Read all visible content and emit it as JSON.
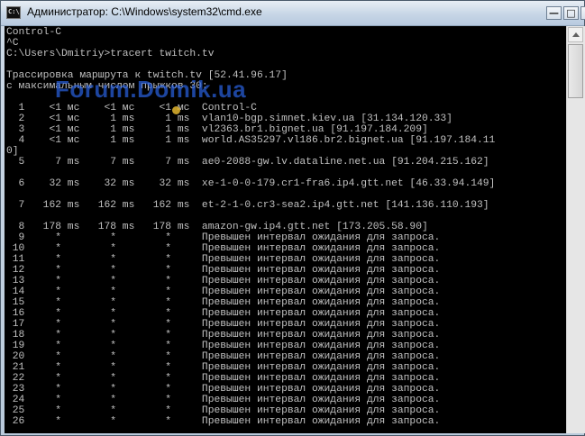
{
  "window": {
    "title": "Администратор: C:\\Windows\\system32\\cmd.exe",
    "buttons": {
      "minimize": "—",
      "maximize": "□",
      "close": ""
    }
  },
  "watermark": "Forum.Domik.ua",
  "console": {
    "lines": [
      "Control-C",
      "^C",
      "C:\\Users\\Dmitriy>tracert twitch.tv",
      "",
      "Трассировка маршрута к twitch.tv [52.41.96.17]",
      "с максимальным числом прыжков 30:",
      "",
      "  1    <1 мс    <1 мс    <1 мс  Control-C",
      "  2    <1 мс     1 ms     1 ms  vlan10-bgp.simnet.kiev.ua [31.134.120.33]",
      "  3    <1 мс     1 ms     1 ms  vl2363.br1.bignet.ua [91.197.184.209]",
      "  4    <1 мс     1 ms     1 ms  world.AS35297.vl186.br2.bignet.ua [91.197.184.11",
      "0]",
      "  5     7 ms     7 ms     7 ms  ae0-2088-gw.lv.dataline.net.ua [91.204.215.162]",
      "",
      "  6    32 ms    32 ms    32 ms  xe-1-0-0-179.cr1-fra6.ip4.gtt.net [46.33.94.149]",
      "",
      "  7   162 ms   162 ms   162 ms  et-2-1-0.cr3-sea2.ip4.gtt.net [141.136.110.193]",
      "",
      "  8   178 ms   178 ms   178 ms  amazon-gw.ip4.gtt.net [173.205.58.90]",
      "  9     *        *        *     Превышен интервал ожидания для запроса.",
      " 10     *        *        *     Превышен интервал ожидания для запроса.",
      " 11     *        *        *     Превышен интервал ожидания для запроса.",
      " 12     *        *        *     Превышен интервал ожидания для запроса.",
      " 13     *        *        *     Превышен интервал ожидания для запроса.",
      " 14     *        *        *     Превышен интервал ожидания для запроса.",
      " 15     *        *        *     Превышен интервал ожидания для запроса.",
      " 16     *        *        *     Превышен интервал ожидания для запроса.",
      " 17     *        *        *     Превышен интервал ожидания для запроса.",
      " 18     *        *        *     Превышен интервал ожидания для запроса.",
      " 19     *        *        *     Превышен интервал ожидания для запроса.",
      " 20     *        *        *     Превышен интервал ожидания для запроса.",
      " 21     *        *        *     Превышен интервал ожидания для запроса.",
      " 22     *        *        *     Превышен интервал ожидания для запроса.",
      " 23     *        *        *     Превышен интервал ожидания для запроса.",
      " 24     *        *        *     Превышен интервал ожидания для запроса.",
      " 25     *        *        *     Превышен интервал ожидания для запроса.",
      " 26     *        *        *     Превышен интервал ожидания для запроса."
    ]
  }
}
